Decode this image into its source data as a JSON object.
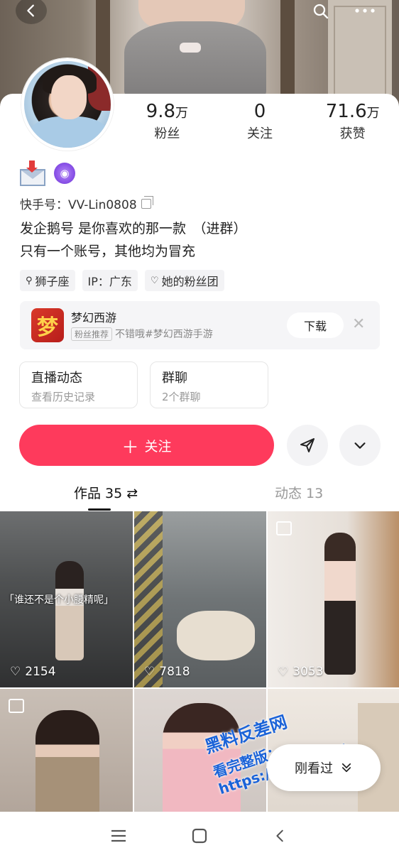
{
  "header": {
    "back_icon": "chevron-left-icon",
    "search_icon": "search-icon",
    "more_icon": "more-dots-icon"
  },
  "profile": {
    "stats": [
      {
        "value": "9.8",
        "unit": "万",
        "label": "粉丝"
      },
      {
        "value": "0",
        "unit": "",
        "label": "关注"
      },
      {
        "value": "71.6",
        "unit": "万",
        "label": "获赞"
      }
    ],
    "kuaishou_id": "快手号：VV-Lin0808",
    "bio_line1": "发企鹅号 是你喜欢的那一款　（进群）",
    "bio_line2": "只有一个账号，其他均为冒充",
    "tags": [
      {
        "icon": "female-icon",
        "label": "狮子座"
      },
      {
        "icon": "",
        "label": "IP：广东"
      },
      {
        "icon": "heart-outline-icon",
        "label": "她的粉丝团"
      }
    ]
  },
  "promo": {
    "logo_char": "梦",
    "game_name": "梦幻西游",
    "pill": "粉丝推荐",
    "desc": "不错哦#梦幻西游手游",
    "download_label": "下载",
    "close_char": "✕"
  },
  "quick_links": [
    {
      "title": "直播动态",
      "sub": "查看历史记录"
    },
    {
      "title": "群聊",
      "sub": "2个群聊"
    }
  ],
  "actions": {
    "follow_label": "关注",
    "plus": "＋"
  },
  "tabs": {
    "works": "作品 35",
    "works_sort_icon": "⇄",
    "moments": "动态 13"
  },
  "videos": [
    {
      "likes": "2154",
      "caption": "「谁还不是个小腰精呢」"
    },
    {
      "likes": "7818",
      "caption": ""
    },
    {
      "likes": "3053",
      "caption": ""
    },
    {
      "likes": "",
      "caption": ""
    },
    {
      "likes": "",
      "caption": ""
    },
    {
      "likes": "",
      "caption": ""
    }
  ],
  "watermark": {
    "line1": "黑料反差网",
    "line2": "看完整版：https://hlcgw.net"
  },
  "seen_pill": {
    "label": "刚看过"
  },
  "colors": {
    "follow": "#fe3a5c",
    "chip_bg": "#f3f3f5"
  }
}
